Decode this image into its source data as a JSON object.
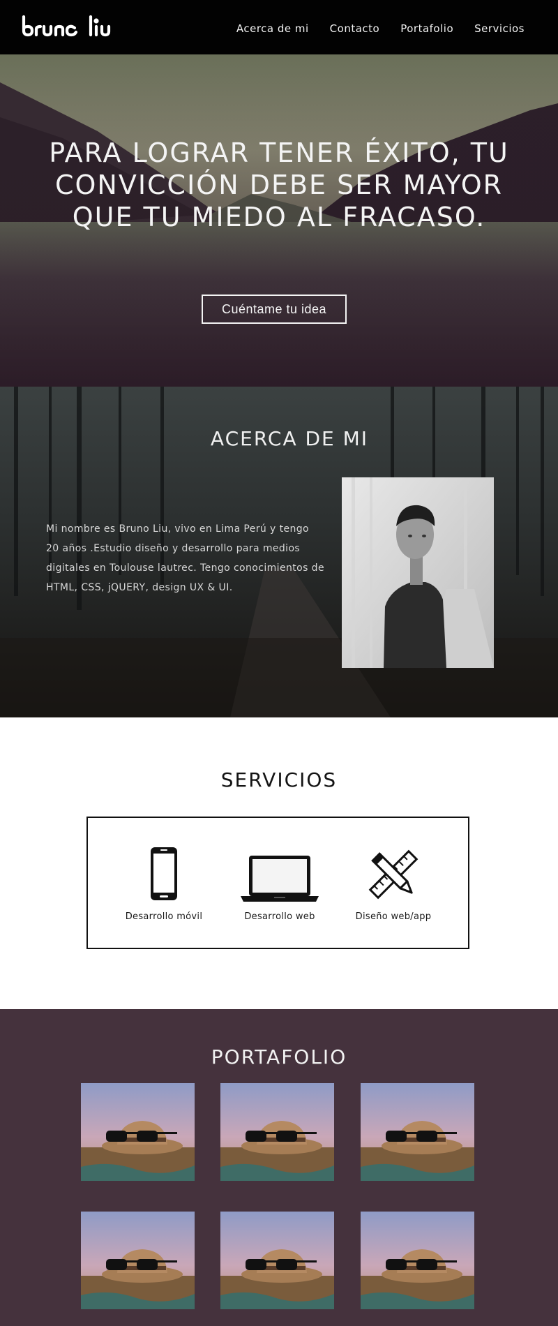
{
  "nav": {
    "logo": "bruno liu",
    "links": [
      "Acerca de mi",
      "Contacto",
      "Portafolio",
      "Servicios"
    ]
  },
  "hero": {
    "quote": "PARA LOGRAR TENER ÉXITO, TU CONVICCIÓN DEBE SER MAYOR QUE TU MIEDO AL FRACASO.",
    "cta": "Cuéntame tu idea"
  },
  "about": {
    "title": "ACERCA DE MI",
    "text": "Mi nombre es Bruno Liu, vivo en Lima Perú y tengo 20 años .Estudio diseño y desarrollo para medios digitales en Toulouse lautrec. Tengo conocimientos de HTML, CSS, jQUERY, design UX & UI."
  },
  "services": {
    "title": "SERVICIOS",
    "items": [
      {
        "label": "Desarrollo móvil",
        "icon": "smartphone-icon"
      },
      {
        "label": "Desarrollo web",
        "icon": "laptop-icon"
      },
      {
        "label": "Diseño web/app",
        "icon": "pencil-ruler-icon"
      }
    ]
  },
  "portfolio": {
    "title": "PORTAFOLIO",
    "items": [
      "hat-sunglasses-photo",
      "hat-sunglasses-photo",
      "hat-sunglasses-photo",
      "hat-sunglasses-photo",
      "hat-sunglasses-photo",
      "hat-sunglasses-photo"
    ]
  },
  "colors": {
    "nav_bg": "#020202",
    "portfolio_bg": "#45323d",
    "text_light": "#f4f4f4"
  }
}
